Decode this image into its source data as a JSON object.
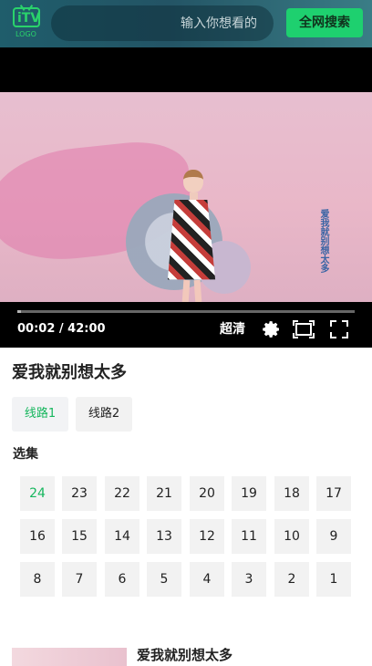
{
  "header": {
    "logo_text": "iTV",
    "logo_sub": "LOGO",
    "search_placeholder": "输入你想看的",
    "search_button": "全网搜索",
    "colors": {
      "accent": "#1ed06f",
      "header_start": "#1f5d6b",
      "header_end": "#3a7d86"
    }
  },
  "player": {
    "overlay_title": "爱我就别想太多",
    "current_time": "00:02",
    "duration": "42:00",
    "time_display": "00:02 / 42:00",
    "quality": "超清",
    "progress": 0.01,
    "icons": [
      "settings-icon",
      "picture-in-picture-icon",
      "fullscreen-icon"
    ]
  },
  "show": {
    "title": "爱我就别想太多",
    "line_tabs": [
      "线路1",
      "线路2"
    ],
    "selected_line": "线路1",
    "episodes_label": "选集",
    "episodes": [
      "24",
      "23",
      "22",
      "21",
      "20",
      "19",
      "18",
      "17",
      "16",
      "15",
      "14",
      "13",
      "12",
      "11",
      "10",
      "9",
      "8",
      "7",
      "6",
      "5",
      "4",
      "3",
      "2",
      "1"
    ],
    "selected_episode": "24"
  },
  "recommendation": {
    "title": "爱我就别想太多"
  }
}
